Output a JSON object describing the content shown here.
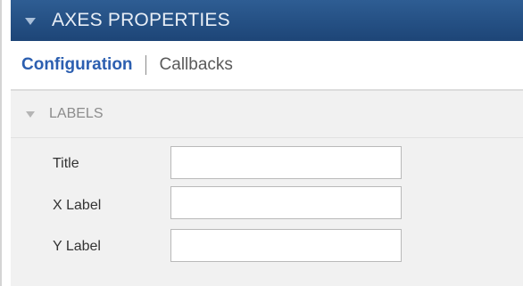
{
  "panel": {
    "title": "AXES PROPERTIES"
  },
  "tabs": [
    {
      "label": "Configuration",
      "active": true
    },
    {
      "label": "Callbacks",
      "active": false
    }
  ],
  "section": {
    "title": "LABELS"
  },
  "fields": {
    "title": {
      "label": "Title",
      "value": ""
    },
    "xlabel": {
      "label": "X Label",
      "value": ""
    },
    "ylabel": {
      "label": "Y Label",
      "value": ""
    }
  },
  "colors": {
    "header_bg": "#1d4577",
    "active_tab": "#2c5fb0",
    "section_bg": "#f1f1f1"
  }
}
